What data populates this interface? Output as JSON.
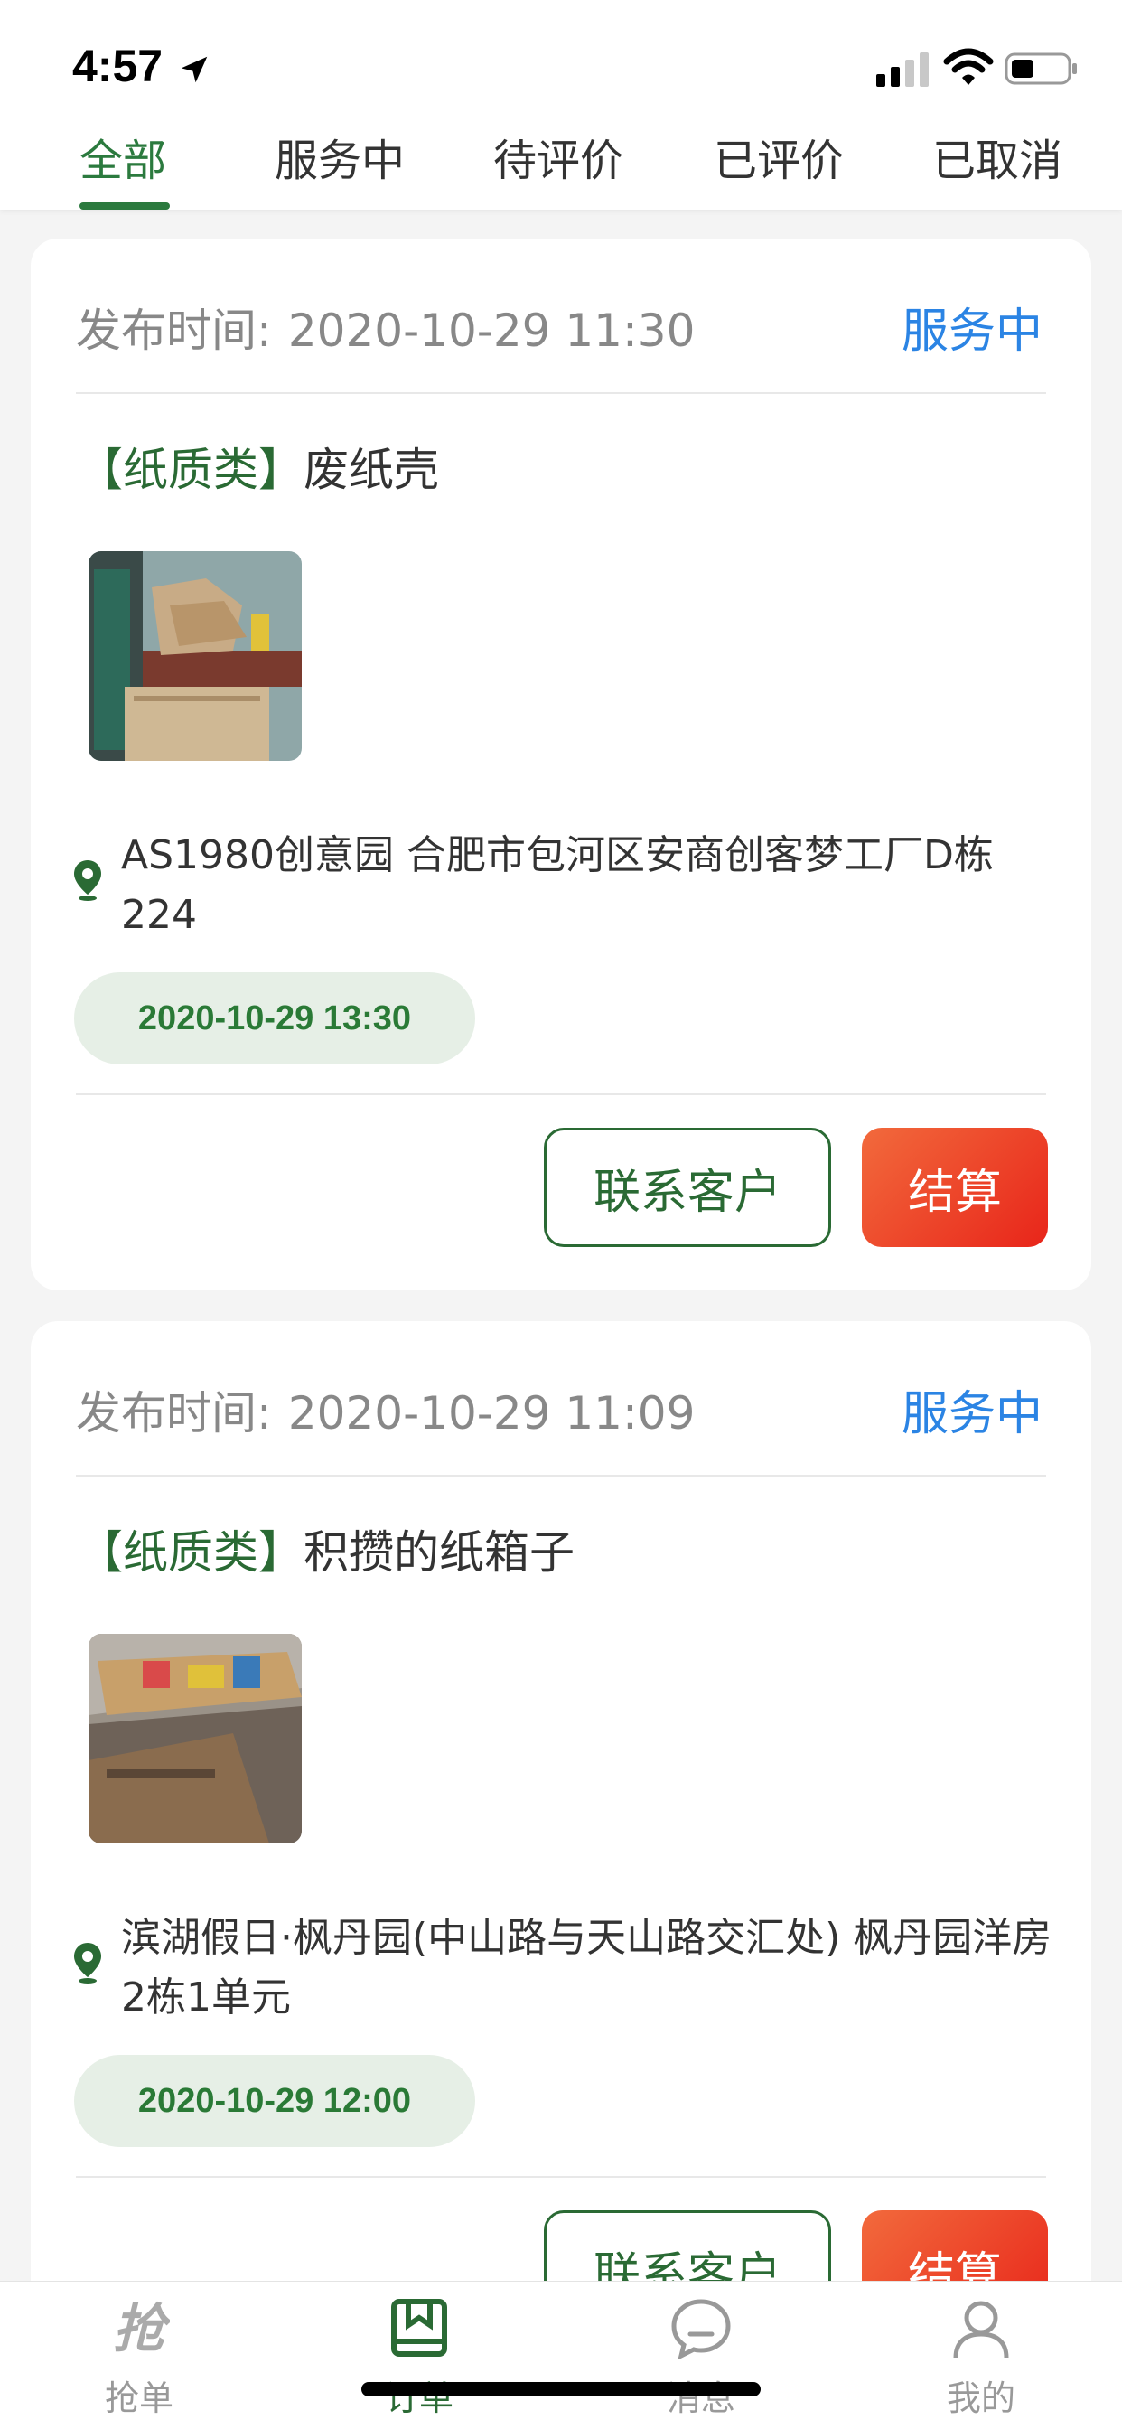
{
  "status_bar": {
    "time": "4:57"
  },
  "tabs": [
    {
      "label": "全部",
      "active": true
    },
    {
      "label": "服务中",
      "active": false
    },
    {
      "label": "待评价",
      "active": false
    },
    {
      "label": "已评价",
      "active": false
    },
    {
      "label": "已取消",
      "active": false
    }
  ],
  "orders": [
    {
      "publish_label": "发布时间:",
      "publish_time": "2020-10-29 11:30",
      "status": "服务中",
      "category": "【纸质类】",
      "name": "废纸壳",
      "address": "AS1980创意园 合肥市包河区安商创客梦工厂D栋224",
      "appointment": "2020-10-29 13:30",
      "contact_label": "联系客户",
      "settle_label": "结算"
    },
    {
      "publish_label": "发布时间:",
      "publish_time": "2020-10-29 11:09",
      "status": "服务中",
      "category": "【纸质类】",
      "name": "积攒的纸箱子",
      "address": "滨湖假日·枫丹园(中山路与天山路交汇处) 枫丹园洋房2栋1单元",
      "appointment": "2020-10-29 12:00",
      "contact_label": "联系客户",
      "settle_label": "结算"
    }
  ],
  "bottom_nav": [
    {
      "label": "抢单",
      "icon": "grab-order-icon"
    },
    {
      "label": "订单",
      "icon": "bookmark-icon",
      "active": true
    },
    {
      "label": "消息",
      "icon": "chat-bubble-icon"
    },
    {
      "label": "我的",
      "icon": "person-icon"
    }
  ],
  "colors": {
    "primary_green": "#2a6a34",
    "status_blue": "#2b84e4",
    "settle_orange": "#f26a3c",
    "background": "#f4f4f4"
  }
}
